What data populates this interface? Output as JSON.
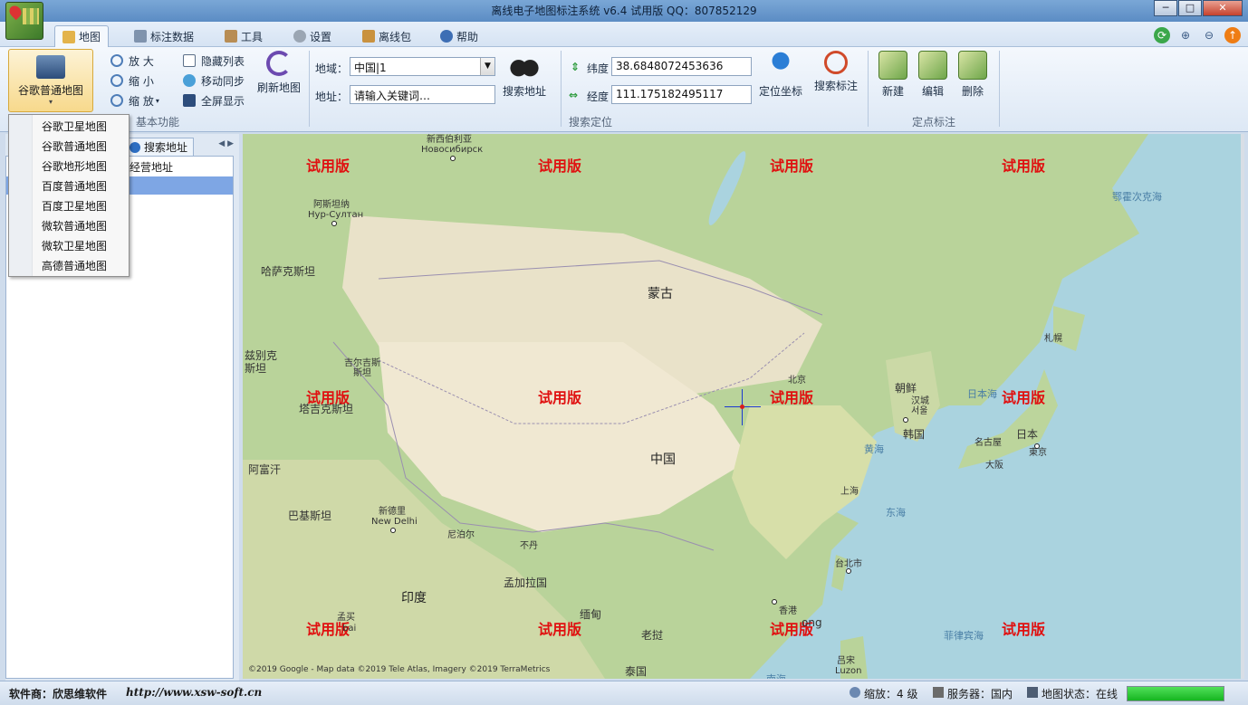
{
  "window": {
    "title": "离线电子地图标注系统 v6.4 试用版 QQ：807852129",
    "buttons": {
      "minimize": "─",
      "maximize": "□",
      "close": "✕"
    }
  },
  "menu": {
    "tabs": [
      {
        "label": "地图",
        "icon": "map-icon",
        "active": true
      },
      {
        "label": "标注数据",
        "icon": "table-icon"
      },
      {
        "label": "工具",
        "icon": "tools-icon"
      },
      {
        "label": "设置",
        "icon": "gear-icon"
      },
      {
        "label": "离线包",
        "icon": "package-icon"
      },
      {
        "label": "帮助",
        "icon": "help-icon"
      }
    ],
    "right_icons": [
      "refresh-icon",
      "zoom-in-icon",
      "zoom-out-icon",
      "update-icon"
    ]
  },
  "ribbon": {
    "map_type_button": "谷歌普通地图",
    "basic": {
      "zoom_in": "放  大",
      "zoom_out": "缩  小",
      "zoom": "缩  放",
      "hide_list": "隐藏列表",
      "move_sync": "移动同步",
      "fullscreen": "全屏显示",
      "refresh_map": "刷新地图",
      "group_label": "基本功能"
    },
    "search": {
      "region_label": "地域：",
      "region_value": "中国|1",
      "address_label": "地址：",
      "address_placeholder": "请输入关键词…",
      "search_address": "搜索地址",
      "group_label": "搜索定位"
    },
    "locate": {
      "lat_label": "纬度",
      "lat_value": "38.6848072453636",
      "lng_label": "经度",
      "lng_value": "111.175182495117",
      "locate_coord": "定位坐标",
      "search_mark": "搜索标注"
    },
    "markers": {
      "new": "新建",
      "edit": "编辑",
      "delete": "删除",
      "group_label": "定点标注"
    }
  },
  "dropdown": {
    "items": [
      "谷歌卫星地图",
      "谷歌普通地图",
      "谷歌地形地图",
      "百度普通地图",
      "百度卫星地图",
      "微软普通地图",
      "微软卫星地图",
      "高德普通地图"
    ]
  },
  "left_panel": {
    "tab_search": "搜索地址",
    "nav": "◀ ▶",
    "tree_item": "经营地址"
  },
  "map": {
    "watermark": "试用版",
    "countries": {
      "mongolia": "蒙古",
      "china": "中国",
      "india": "印度",
      "kazakhstan": "哈萨克斯坦",
      "kyrgyzstan_line1": "吉尔吉斯",
      "kyrgyzstan_line2": "斯坦",
      "tajikistan": "塔吉克斯坦",
      "afghanistan": "阿富汗",
      "pakistan": "巴基斯坦",
      "uzbekistan_line1": "兹别克",
      "uzbekistan_line2": "斯坦",
      "nepal": "尼泊尔",
      "bhutan": "不丹",
      "bangladesh": "孟加拉国",
      "myanmar": "缅甸",
      "laos": "老挝",
      "thailand": "泰国",
      "korea": "朝鲜",
      "south_korea": "韩国",
      "japan": "日本"
    },
    "cities": {
      "novosibirsk_cn": "新西伯利亚",
      "novosibirsk_ru": "Новосибирск",
      "astana_cn": "阿斯坦纳",
      "astana_kz": "Нур-Султан",
      "newdelhi_cn": "新德里",
      "newdelhi_en": "New Delhi",
      "beijing": "北京",
      "shanghai": "上海",
      "taipei": "台北市",
      "hongkong_cn": "香港",
      "hongkong_en": "ong",
      "seoul_cn": "汉城",
      "seoul_kr": "서울",
      "sapporo": "札幌",
      "nagoya": "名古屋",
      "tokyo": "東京",
      "osaka": "大阪",
      "luzon_cn": "吕宋",
      "luzon_en": "Luzon",
      "mumbai_cn": "孟买",
      "mumbai_en": "bai"
    },
    "seas": {
      "okhotsk": "鄂霍次克海",
      "japan_sea": "日本海",
      "yellow_sea": "黄海",
      "east_sea": "东海",
      "philippine_sea": "菲律宾海",
      "south_sea": "南海"
    },
    "copyright": "©2019 Google - Map data ©2019 Tele Atlas, Imagery ©2019 TerraMetrics"
  },
  "status": {
    "vendor": "软件商：欣思维软件",
    "url": "http://www.xsw-soft.cn",
    "zoom": "缩放：4 级",
    "server": "服务器：国内",
    "map_state": "地图状态：在线",
    "progress": 1.0
  },
  "colors": {
    "watermark": "#e01010",
    "crosshair": "#1b3ad0",
    "progress": "#16b521",
    "selection": "#7ea6e4"
  }
}
